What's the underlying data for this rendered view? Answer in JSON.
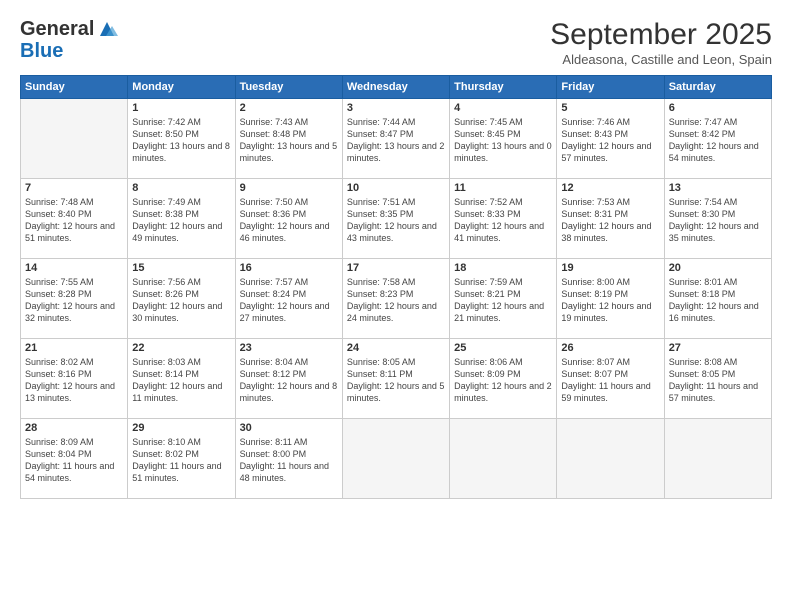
{
  "logo": {
    "line1": "General",
    "line2": "Blue"
  },
  "title": "September 2025",
  "subtitle": "Aldeasona, Castille and Leon, Spain",
  "days_of_week": [
    "Sunday",
    "Monday",
    "Tuesday",
    "Wednesday",
    "Thursday",
    "Friday",
    "Saturday"
  ],
  "weeks": [
    [
      {
        "day": null
      },
      {
        "day": "1",
        "sunrise": "7:42 AM",
        "sunset": "8:50 PM",
        "daylight": "13 hours and 8 minutes."
      },
      {
        "day": "2",
        "sunrise": "7:43 AM",
        "sunset": "8:48 PM",
        "daylight": "13 hours and 5 minutes."
      },
      {
        "day": "3",
        "sunrise": "7:44 AM",
        "sunset": "8:47 PM",
        "daylight": "13 hours and 2 minutes."
      },
      {
        "day": "4",
        "sunrise": "7:45 AM",
        "sunset": "8:45 PM",
        "daylight": "13 hours and 0 minutes."
      },
      {
        "day": "5",
        "sunrise": "7:46 AM",
        "sunset": "8:43 PM",
        "daylight": "12 hours and 57 minutes."
      },
      {
        "day": "6",
        "sunrise": "7:47 AM",
        "sunset": "8:42 PM",
        "daylight": "12 hours and 54 minutes."
      }
    ],
    [
      {
        "day": "7",
        "sunrise": "7:48 AM",
        "sunset": "8:40 PM",
        "daylight": "12 hours and 51 minutes."
      },
      {
        "day": "8",
        "sunrise": "7:49 AM",
        "sunset": "8:38 PM",
        "daylight": "12 hours and 49 minutes."
      },
      {
        "day": "9",
        "sunrise": "7:50 AM",
        "sunset": "8:36 PM",
        "daylight": "12 hours and 46 minutes."
      },
      {
        "day": "10",
        "sunrise": "7:51 AM",
        "sunset": "8:35 PM",
        "daylight": "12 hours and 43 minutes."
      },
      {
        "day": "11",
        "sunrise": "7:52 AM",
        "sunset": "8:33 PM",
        "daylight": "12 hours and 41 minutes."
      },
      {
        "day": "12",
        "sunrise": "7:53 AM",
        "sunset": "8:31 PM",
        "daylight": "12 hours and 38 minutes."
      },
      {
        "day": "13",
        "sunrise": "7:54 AM",
        "sunset": "8:30 PM",
        "daylight": "12 hours and 35 minutes."
      }
    ],
    [
      {
        "day": "14",
        "sunrise": "7:55 AM",
        "sunset": "8:28 PM",
        "daylight": "12 hours and 32 minutes."
      },
      {
        "day": "15",
        "sunrise": "7:56 AM",
        "sunset": "8:26 PM",
        "daylight": "12 hours and 30 minutes."
      },
      {
        "day": "16",
        "sunrise": "7:57 AM",
        "sunset": "8:24 PM",
        "daylight": "12 hours and 27 minutes."
      },
      {
        "day": "17",
        "sunrise": "7:58 AM",
        "sunset": "8:23 PM",
        "daylight": "12 hours and 24 minutes."
      },
      {
        "day": "18",
        "sunrise": "7:59 AM",
        "sunset": "8:21 PM",
        "daylight": "12 hours and 21 minutes."
      },
      {
        "day": "19",
        "sunrise": "8:00 AM",
        "sunset": "8:19 PM",
        "daylight": "12 hours and 19 minutes."
      },
      {
        "day": "20",
        "sunrise": "8:01 AM",
        "sunset": "8:18 PM",
        "daylight": "12 hours and 16 minutes."
      }
    ],
    [
      {
        "day": "21",
        "sunrise": "8:02 AM",
        "sunset": "8:16 PM",
        "daylight": "12 hours and 13 minutes."
      },
      {
        "day": "22",
        "sunrise": "8:03 AM",
        "sunset": "8:14 PM",
        "daylight": "12 hours and 11 minutes."
      },
      {
        "day": "23",
        "sunrise": "8:04 AM",
        "sunset": "8:12 PM",
        "daylight": "12 hours and 8 minutes."
      },
      {
        "day": "24",
        "sunrise": "8:05 AM",
        "sunset": "8:11 PM",
        "daylight": "12 hours and 5 minutes."
      },
      {
        "day": "25",
        "sunrise": "8:06 AM",
        "sunset": "8:09 PM",
        "daylight": "12 hours and 2 minutes."
      },
      {
        "day": "26",
        "sunrise": "8:07 AM",
        "sunset": "8:07 PM",
        "daylight": "11 hours and 59 minutes."
      },
      {
        "day": "27",
        "sunrise": "8:08 AM",
        "sunset": "8:05 PM",
        "daylight": "11 hours and 57 minutes."
      }
    ],
    [
      {
        "day": "28",
        "sunrise": "8:09 AM",
        "sunset": "8:04 PM",
        "daylight": "11 hours and 54 minutes."
      },
      {
        "day": "29",
        "sunrise": "8:10 AM",
        "sunset": "8:02 PM",
        "daylight": "11 hours and 51 minutes."
      },
      {
        "day": "30",
        "sunrise": "8:11 AM",
        "sunset": "8:00 PM",
        "daylight": "11 hours and 48 minutes."
      },
      {
        "day": null
      },
      {
        "day": null
      },
      {
        "day": null
      },
      {
        "day": null
      }
    ]
  ]
}
